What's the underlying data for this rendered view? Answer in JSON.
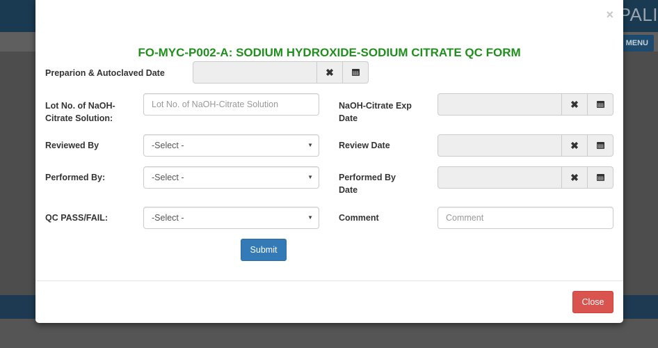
{
  "background": {
    "brand_text": "PALI",
    "menu_label": "MENU"
  },
  "modal": {
    "close_glyph": "×",
    "title": "FO-MYC-P002-A: SODIUM HYDROXIDE-SODIUM CITRATE QC FORM",
    "fields": {
      "prep_date_label": "Preparion & Autoclaved Date",
      "lot_label": "Lot No. of NaOH-Citrate Solution:",
      "lot_placeholder": "Lot No. of NaOH-Citrate Solution",
      "exp_date_label": "NaOH-Citrate Exp Date",
      "reviewed_by_label": "Reviewed By",
      "reviewed_by_value": "-Select -",
      "review_date_label": "Review Date",
      "performed_by_label": "Performed By:",
      "performed_by_value": "-Select -",
      "performed_date_label": "Performed By Date",
      "qc_label": "QC PASS/FAIL:",
      "qc_value": "-Select -",
      "comment_label": "Comment",
      "comment_placeholder": "Comment"
    },
    "submit_label": "Submit",
    "close_label": "Close",
    "icons": {
      "clear": "times-icon",
      "calendar": "calendar-icon"
    },
    "colors": {
      "title": "#208f1e",
      "submit": "#337ab7",
      "close": "#d9534f"
    }
  }
}
